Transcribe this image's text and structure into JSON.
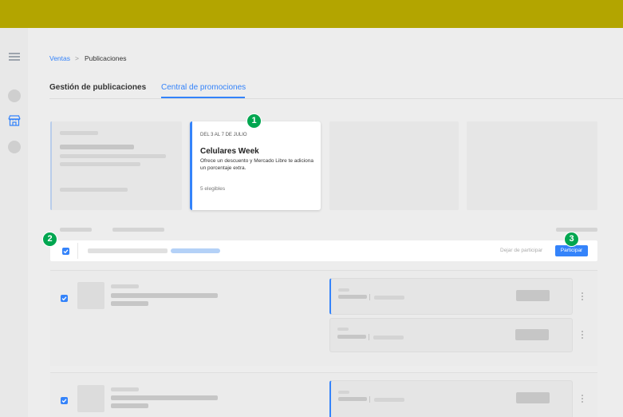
{
  "header": {
    "bg_color": "#b3a500"
  },
  "sidebar": {
    "icons": [
      "menu-icon",
      "circle-placeholder-icon",
      "store-icon",
      "circle-placeholder-icon"
    ]
  },
  "breadcrumb": {
    "parent": "Ventas",
    "separator": ">",
    "current": "Publicaciones"
  },
  "tabs": [
    {
      "label": "Gestión de publicaciones",
      "active": false
    },
    {
      "label": "Central de promociones",
      "active": true
    }
  ],
  "promo_card": {
    "date": "DEL 3 AL 7 DE JULIO",
    "title": "Celulares Week",
    "description": "Ofrece un descuento y Mercado Libre te adiciona un porcentaje extra.",
    "eligible": "5 elegibles"
  },
  "selection_bar": {
    "leave_label": "Dejar de participar",
    "participate_label": "Participar"
  },
  "badges": [
    "1",
    "2",
    "3"
  ],
  "colors": {
    "accent": "#3483fa",
    "badge": "#00a650"
  }
}
